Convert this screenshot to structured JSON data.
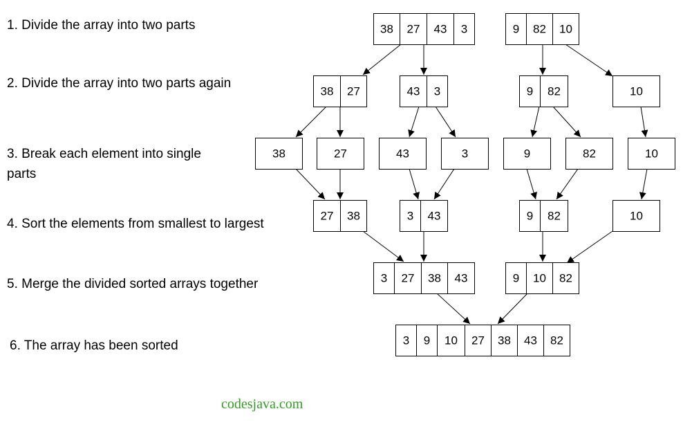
{
  "steps": [
    {
      "id": "1",
      "lines": [
        "1. Divide the array into two parts"
      ]
    },
    {
      "id": "2",
      "lines": [
        "2. Divide the array into two parts again"
      ]
    },
    {
      "id": "3",
      "lines": [
        "3. Break each element into single",
        "parts"
      ]
    },
    {
      "id": "4",
      "lines": [
        "4. Sort the  elements from smallest to largest"
      ]
    },
    {
      "id": "5",
      "lines": [
        "5. Merge the divided sorted arrays together"
      ]
    },
    {
      "id": "6",
      "lines": [
        "6. The array has been sorted"
      ]
    }
  ],
  "arrays": {
    "l1a": [
      "38",
      "27",
      "43",
      "3"
    ],
    "l1b": [
      "9",
      "82",
      "10"
    ],
    "l2a": [
      "38",
      "27"
    ],
    "l2b": [
      "43",
      "3"
    ],
    "l2c": [
      "9",
      "82"
    ],
    "l2d": [
      "10"
    ],
    "l3a": [
      "38"
    ],
    "l3b": [
      "27"
    ],
    "l3c": [
      "43"
    ],
    "l3d": [
      "3"
    ],
    "l3e": [
      "9"
    ],
    "l3f": [
      "82"
    ],
    "l3g": [
      "10"
    ],
    "l4a": [
      "27",
      "38"
    ],
    "l4b": [
      "3",
      "43"
    ],
    "l4c": [
      "9",
      "82"
    ],
    "l4d": [
      "10"
    ],
    "l5a": [
      "3",
      "27",
      "38",
      "43"
    ],
    "l5b": [
      "9",
      "10",
      "82"
    ],
    "l6": [
      "3",
      "9",
      "10",
      "27",
      "38",
      "43",
      "82"
    ]
  },
  "watermark": {
    "text": "codesjava.com",
    "color": "#2e9e1f"
  },
  "colors": {
    "line": "#000000",
    "box_fill": "#ffffff"
  }
}
